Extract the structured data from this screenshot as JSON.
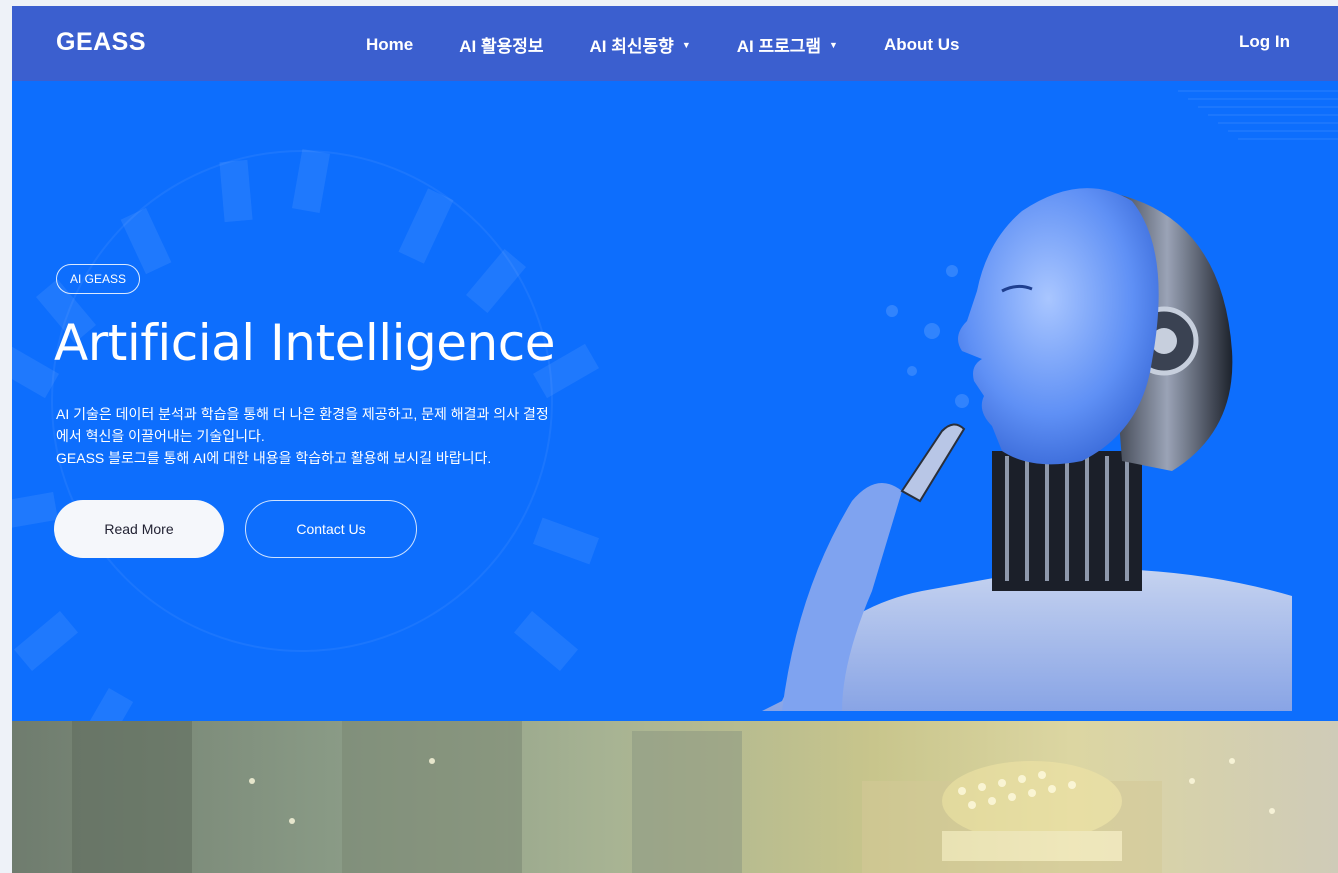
{
  "navbar": {
    "brand": "GEASS",
    "items": [
      {
        "label": "Home",
        "dropdown": false
      },
      {
        "label": "AI 활용정보",
        "dropdown": false
      },
      {
        "label": "AI 최신동향",
        "dropdown": true
      },
      {
        "label": "AI 프로그램",
        "dropdown": true
      },
      {
        "label": "About Us",
        "dropdown": false
      }
    ],
    "login": "Log In"
  },
  "hero": {
    "badge": "AI GEASS",
    "title": "Artificial Intelligence",
    "description": [
      "AI 기술은 데이터 분석과 학습을 통해 더 나은 환경을 제공하고, 문제 해결과 의사 결정",
      "에서 혁신을 이끌어내는 기술입니다.",
      "GEASS 블로그를 통해 AI에 대한 내용을 학습하고 활용해 보시길 바랍니다."
    ],
    "read_more": "Read More",
    "contact_us": "Contact Us"
  },
  "colors": {
    "navbar": "#3b5fcf",
    "hero_bg": "#0d6efd",
    "button_light": "#f5f7fb"
  }
}
